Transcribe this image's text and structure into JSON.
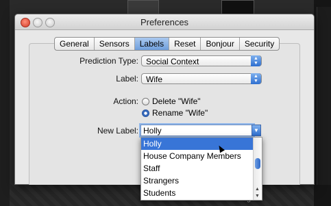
{
  "window": {
    "title": "Preferences"
  },
  "tabs": [
    {
      "label": "General",
      "active": false
    },
    {
      "label": "Sensors",
      "active": false
    },
    {
      "label": "Labels",
      "active": true
    },
    {
      "label": "Reset",
      "active": false
    },
    {
      "label": "Bonjour",
      "active": false
    },
    {
      "label": "Security",
      "active": false
    }
  ],
  "form": {
    "prediction_type": {
      "label": "Prediction Type:",
      "value": "Social Context"
    },
    "label_field": {
      "label": "Label:",
      "value": "Wife"
    },
    "action": {
      "label": "Action:",
      "options": [
        {
          "label": "Delete \"Wife\"",
          "selected": false
        },
        {
          "label": "Rename \"Wife\"",
          "selected": true
        }
      ]
    },
    "new_label": {
      "label": "New Label:",
      "value": "Holly"
    }
  },
  "dropdown": {
    "items": [
      {
        "label": "Holly",
        "selected": true
      },
      {
        "label": "House Company Members",
        "selected": false
      },
      {
        "label": "Staff",
        "selected": false
      },
      {
        "label": "Strangers",
        "selected": false
      },
      {
        "label": "Students",
        "selected": false
      }
    ]
  },
  "background": {
    "bottom_text": "training"
  },
  "colors": {
    "accent": "#3875d7",
    "tab_active": "#8fb6ea"
  }
}
